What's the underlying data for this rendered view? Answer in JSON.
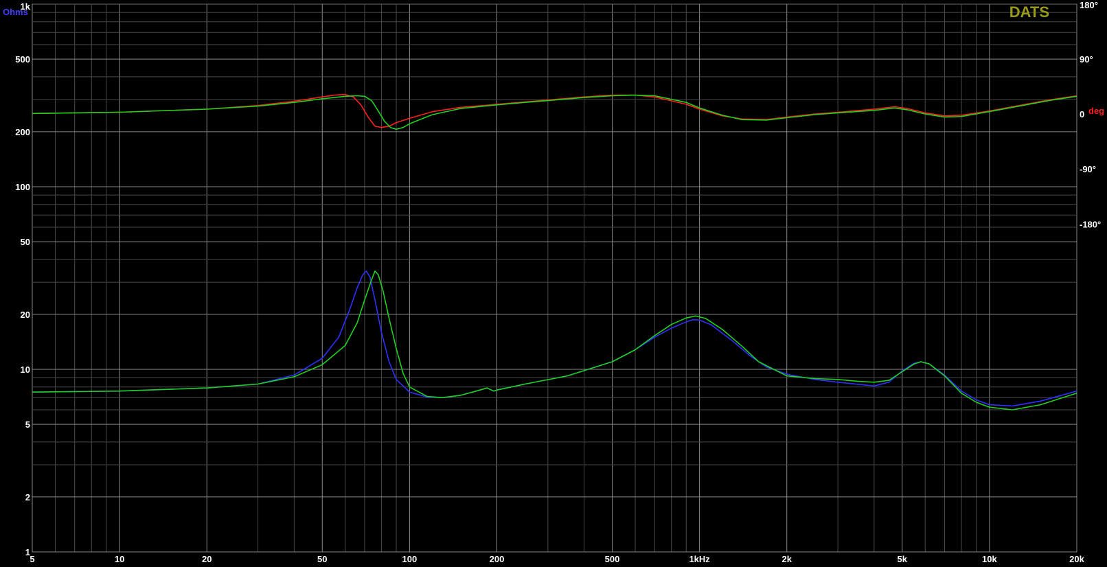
{
  "brand": "DATS",
  "chart_data": {
    "type": "line",
    "x_scale": "log",
    "y_scale": "log",
    "xlim": [
      5,
      20000
    ],
    "ylim_left": [
      1,
      1000
    ],
    "ylim_right": [
      -180,
      180
    ],
    "y_left_unit": "Ohms",
    "y_right_unit": "deg",
    "grid": true,
    "x_tick_labels": [
      {
        "v": 5,
        "t": "5"
      },
      {
        "v": 10,
        "t": "10"
      },
      {
        "v": 20,
        "t": "20"
      },
      {
        "v": 50,
        "t": "50"
      },
      {
        "v": 100,
        "t": "100"
      },
      {
        "v": 200,
        "t": "200"
      },
      {
        "v": 500,
        "t": "500"
      },
      {
        "v": 1000,
        "t": "1kHz"
      },
      {
        "v": 2000,
        "t": "2k"
      },
      {
        "v": 5000,
        "t": "5k"
      },
      {
        "v": 10000,
        "t": "10k"
      },
      {
        "v": 20000,
        "t": "20k"
      }
    ],
    "y_left_tick_labels": [
      {
        "v": 1,
        "t": "1"
      },
      {
        "v": 2,
        "t": "2"
      },
      {
        "v": 5,
        "t": "5"
      },
      {
        "v": 10,
        "t": "10"
      },
      {
        "v": 20,
        "t": "20"
      },
      {
        "v": 50,
        "t": "50"
      },
      {
        "v": 100,
        "t": "100"
      },
      {
        "v": 200,
        "t": "200"
      },
      {
        "v": 500,
        "t": "500"
      },
      {
        "v": 1000,
        "t": "1k"
      }
    ],
    "y_right_tick_labels": [
      {
        "v": 180,
        "t": "180°"
      },
      {
        "v": 90,
        "t": "90°"
      },
      {
        "v": 0,
        "t": "0"
      },
      {
        "v": -90,
        "t": "-90°"
      },
      {
        "v": -180,
        "t": "-180°"
      }
    ],
    "series": [
      {
        "axis": "left",
        "color": "#3030ff",
        "points": [
          [
            5,
            7.5
          ],
          [
            10,
            7.6
          ],
          [
            20,
            7.9
          ],
          [
            30,
            8.3
          ],
          [
            40,
            9.3
          ],
          [
            50,
            11.5
          ],
          [
            57,
            15
          ],
          [
            62,
            21
          ],
          [
            66,
            28
          ],
          [
            69,
            33
          ],
          [
            71,
            34.5
          ],
          [
            73,
            32
          ],
          [
            76,
            24
          ],
          [
            80,
            16
          ],
          [
            85,
            11
          ],
          [
            90,
            8.8
          ],
          [
            100,
            7.5
          ],
          [
            115,
            7.05
          ],
          [
            130,
            7.0
          ],
          [
            150,
            7.2
          ],
          [
            170,
            7.6
          ],
          [
            185,
            7.9
          ],
          [
            195,
            7.6
          ],
          [
            200,
            7.7
          ],
          [
            250,
            8.3
          ],
          [
            350,
            9.2
          ],
          [
            500,
            11.0
          ],
          [
            600,
            12.8
          ],
          [
            700,
            15
          ],
          [
            800,
            16.8
          ],
          [
            900,
            18.2
          ],
          [
            950,
            18.7
          ],
          [
            1000,
            18.6
          ],
          [
            1100,
            17.5
          ],
          [
            1300,
            14.3
          ],
          [
            1500,
            11.8
          ],
          [
            1700,
            10.3
          ],
          [
            2000,
            9.4
          ],
          [
            2500,
            8.8
          ],
          [
            3000,
            8.5
          ],
          [
            4000,
            8.1
          ],
          [
            4500,
            8.5
          ],
          [
            5000,
            9.8
          ],
          [
            5500,
            10.8
          ],
          [
            5800,
            11.0
          ],
          [
            6200,
            10.7
          ],
          [
            7000,
            9.3
          ],
          [
            8000,
            7.6
          ],
          [
            9000,
            6.8
          ],
          [
            10000,
            6.4
          ],
          [
            12000,
            6.3
          ],
          [
            15000,
            6.7
          ],
          [
            20000,
            7.6
          ]
        ]
      },
      {
        "axis": "left",
        "color": "#20d020",
        "points": [
          [
            5,
            7.5
          ],
          [
            10,
            7.6
          ],
          [
            20,
            7.9
          ],
          [
            30,
            8.3
          ],
          [
            40,
            9.1
          ],
          [
            50,
            10.6
          ],
          [
            60,
            13.5
          ],
          [
            66,
            18
          ],
          [
            70,
            24
          ],
          [
            74,
            31
          ],
          [
            76,
            34.5
          ],
          [
            78,
            33
          ],
          [
            81,
            27
          ],
          [
            85,
            19
          ],
          [
            90,
            13
          ],
          [
            95,
            9.5
          ],
          [
            100,
            8
          ],
          [
            115,
            7.1
          ],
          [
            130,
            7.0
          ],
          [
            150,
            7.2
          ],
          [
            170,
            7.6
          ],
          [
            185,
            7.9
          ],
          [
            195,
            7.6
          ],
          [
            200,
            7.7
          ],
          [
            250,
            8.3
          ],
          [
            350,
            9.2
          ],
          [
            500,
            11.0
          ],
          [
            600,
            12.8
          ],
          [
            700,
            15.3
          ],
          [
            800,
            17.6
          ],
          [
            900,
            19.1
          ],
          [
            970,
            19.6
          ],
          [
            1050,
            19.0
          ],
          [
            1200,
            16.5
          ],
          [
            1400,
            13.4
          ],
          [
            1600,
            11.0
          ],
          [
            2000,
            9.2
          ],
          [
            2500,
            8.9
          ],
          [
            3000,
            8.8
          ],
          [
            3500,
            8.6
          ],
          [
            4000,
            8.5
          ],
          [
            4500,
            8.7
          ],
          [
            5000,
            9.7
          ],
          [
            5500,
            10.7
          ],
          [
            5800,
            11.0
          ],
          [
            6200,
            10.7
          ],
          [
            7000,
            9.2
          ],
          [
            8000,
            7.4
          ],
          [
            9000,
            6.6
          ],
          [
            10000,
            6.2
          ],
          [
            12000,
            6.0
          ],
          [
            15000,
            6.4
          ],
          [
            20000,
            7.4
          ]
        ]
      },
      {
        "axis": "right",
        "color": "#ff2020",
        "points": [
          [
            5,
            1
          ],
          [
            10,
            3
          ],
          [
            20,
            8
          ],
          [
            30,
            14
          ],
          [
            40,
            21
          ],
          [
            50,
            28
          ],
          [
            55,
            31
          ],
          [
            60,
            32
          ],
          [
            64,
            28
          ],
          [
            68,
            15
          ],
          [
            72,
            -5
          ],
          [
            76,
            -20
          ],
          [
            80,
            -22
          ],
          [
            85,
            -20
          ],
          [
            90,
            -14
          ],
          [
            100,
            -7
          ],
          [
            120,
            4
          ],
          [
            150,
            11
          ],
          [
            190,
            15
          ],
          [
            200,
            16
          ],
          [
            250,
            20
          ],
          [
            300,
            23
          ],
          [
            400,
            28
          ],
          [
            500,
            31
          ],
          [
            600,
            31
          ],
          [
            700,
            28
          ],
          [
            900,
            16
          ],
          [
            1000,
            8
          ],
          [
            1200,
            -3
          ],
          [
            1400,
            -8
          ],
          [
            1700,
            -9
          ],
          [
            2000,
            -5
          ],
          [
            2500,
            0
          ],
          [
            3000,
            3
          ],
          [
            4000,
            8
          ],
          [
            4700,
            12
          ],
          [
            5200,
            9
          ],
          [
            6000,
            2
          ],
          [
            7000,
            -3
          ],
          [
            8000,
            -2
          ],
          [
            10000,
            5
          ],
          [
            13000,
            15
          ],
          [
            16000,
            23
          ],
          [
            20000,
            30
          ]
        ]
      },
      {
        "axis": "right",
        "color": "#20d020",
        "points": [
          [
            5,
            1
          ],
          [
            10,
            3
          ],
          [
            20,
            8
          ],
          [
            30,
            13
          ],
          [
            40,
            19
          ],
          [
            50,
            25
          ],
          [
            60,
            29
          ],
          [
            66,
            30
          ],
          [
            70,
            29
          ],
          [
            74,
            22
          ],
          [
            78,
            5
          ],
          [
            82,
            -12
          ],
          [
            86,
            -22
          ],
          [
            90,
            -25
          ],
          [
            95,
            -22
          ],
          [
            100,
            -16
          ],
          [
            110,
            -8
          ],
          [
            120,
            -1
          ],
          [
            150,
            9
          ],
          [
            190,
            14
          ],
          [
            200,
            15
          ],
          [
            250,
            19
          ],
          [
            300,
            22
          ],
          [
            400,
            27
          ],
          [
            500,
            30
          ],
          [
            600,
            31
          ],
          [
            700,
            30
          ],
          [
            900,
            19
          ],
          [
            1000,
            10
          ],
          [
            1200,
            -2
          ],
          [
            1400,
            -9
          ],
          [
            1700,
            -10
          ],
          [
            2000,
            -6
          ],
          [
            2500,
            -1
          ],
          [
            3000,
            2
          ],
          [
            4000,
            6
          ],
          [
            4700,
            10
          ],
          [
            5200,
            7
          ],
          [
            6000,
            0
          ],
          [
            7000,
            -5
          ],
          [
            8000,
            -4
          ],
          [
            10000,
            4
          ],
          [
            13000,
            14
          ],
          [
            16000,
            22
          ],
          [
            20000,
            29
          ]
        ]
      }
    ]
  }
}
